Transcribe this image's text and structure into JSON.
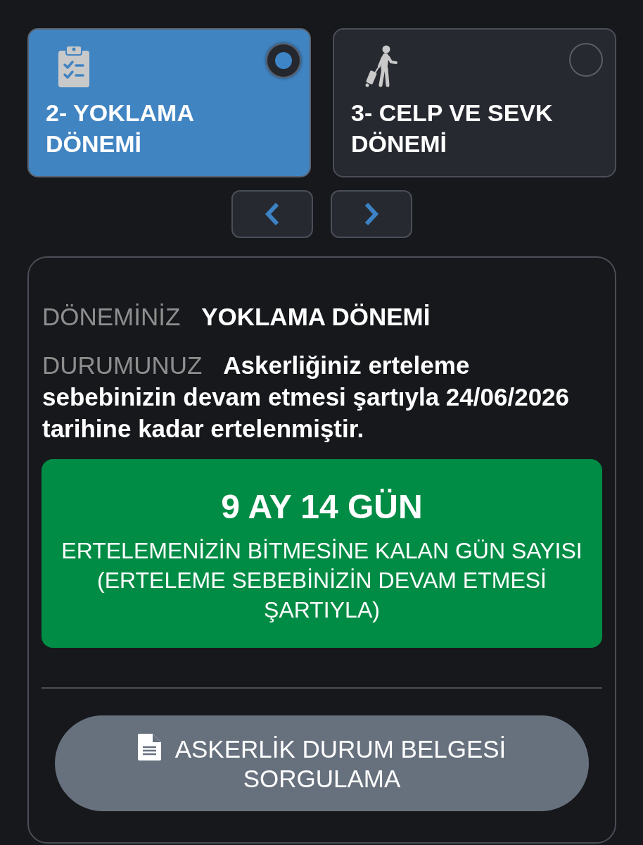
{
  "periods": [
    {
      "kind": "clipboard",
      "title": "2- YOKLAMA DÖNEMİ",
      "selected": true
    },
    {
      "kind": "traveler",
      "title": "3- CELP VE SEVK DÖNEMİ",
      "selected": false
    }
  ],
  "status": {
    "fields": [
      {
        "label": "DÖNEMİNİZ",
        "value": "YOKLAMA DÖNEMİ"
      },
      {
        "label": "DURUMUNUZ",
        "value": "Askerliğiniz erteleme sebebinizin devam etmesi şartıyla 24/06/2026 tarihine kadar ertelenmiştir."
      }
    ],
    "countdown": {
      "value": "9 AY 14 GÜN",
      "caption": "ERTELEMENİZİN BİTMESİNE KALAN GÜN SAYISI (ERTELEME SEBEBİNİZİN DEVAM ETMESİ ŞARTIYLA)"
    }
  },
  "document_button": "ASKERLİK DURUM BELGESİ SORGULAMA"
}
